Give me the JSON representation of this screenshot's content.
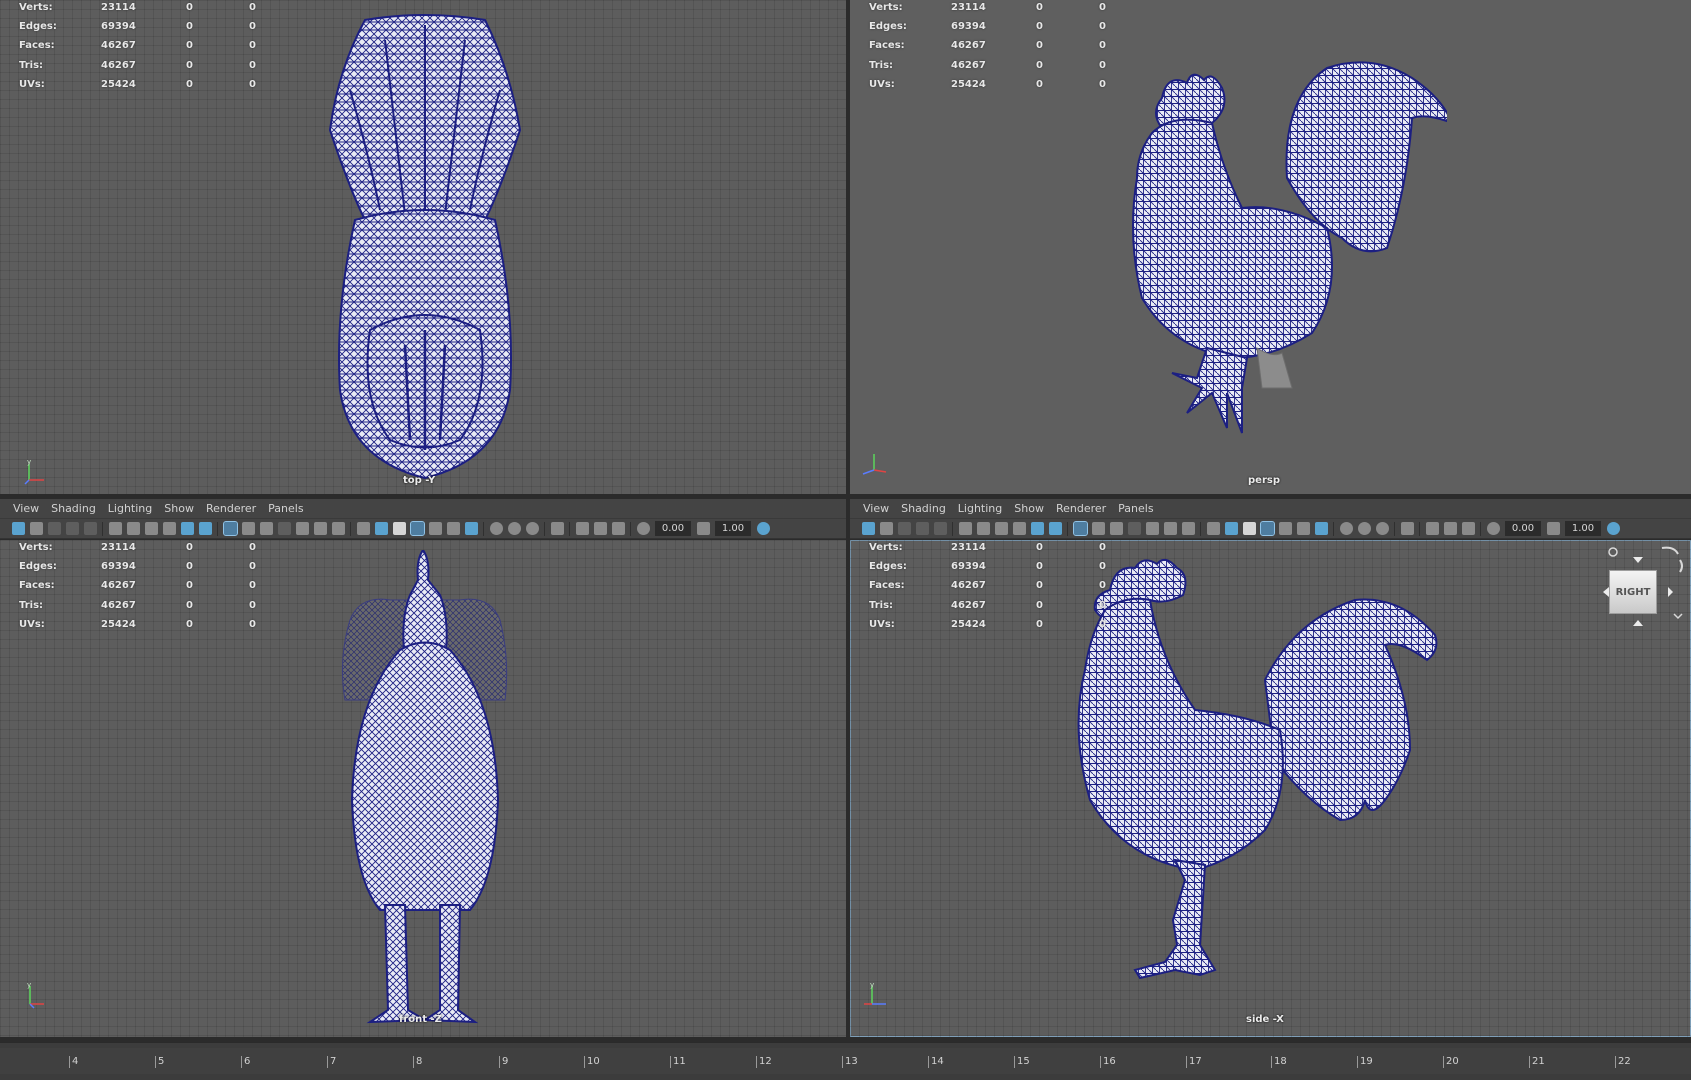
{
  "hud": {
    "rows": [
      {
        "key": "Verts:",
        "v1": "23114",
        "v2": "0",
        "v3": "0"
      },
      {
        "key": "Edges:",
        "v1": "69394",
        "v2": "0",
        "v3": "0"
      },
      {
        "key": "Faces:",
        "v1": "46267",
        "v2": "0",
        "v3": "0"
      },
      {
        "key": "Tris:",
        "v1": "46267",
        "v2": "0",
        "v3": "0"
      },
      {
        "key": "UVs:",
        "v1": "25424",
        "v2": "0",
        "v3": "0"
      }
    ]
  },
  "panels": {
    "top": {
      "camera": "top -Y"
    },
    "persp": {
      "camera": "persp"
    },
    "front": {
      "camera": "front -Z"
    },
    "side": {
      "camera": "side -X"
    }
  },
  "menu": {
    "items": [
      "View",
      "Shading",
      "Lighting",
      "Show",
      "Renderer",
      "Panels"
    ]
  },
  "toolbar": {
    "exposure": "0.00",
    "gamma": "1.00"
  },
  "viewcube": {
    "face": "RIGHT"
  },
  "timeline": {
    "labels": [
      "4",
      "5",
      "6",
      "7",
      "8",
      "9",
      "10",
      "11",
      "12",
      "13",
      "14",
      "15",
      "16",
      "17",
      "18",
      "19",
      "20",
      "21",
      "22"
    ]
  },
  "colors": {
    "wire": "#1c1f82",
    "viewport_bg": "#5d5d5d",
    "panel_ui": "#444444"
  },
  "icons": {
    "axis": "axis-gizmo-icon",
    "cube": "view-cube-icon"
  }
}
